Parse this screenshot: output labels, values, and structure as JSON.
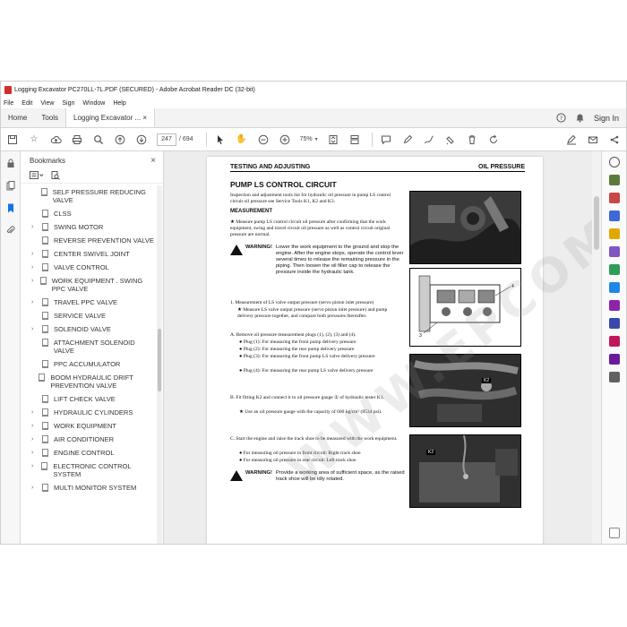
{
  "window": {
    "title": "Logging Excavator PC270LL-7L.PDF (SECURED) - Adobe Acrobat Reader DC (32-bit)"
  },
  "menu": [
    "File",
    "Edit",
    "View",
    "Sign",
    "Window",
    "Help"
  ],
  "tabs": {
    "home": "Home",
    "tools": "Tools",
    "document": "Logging Excavator ...",
    "close": "×",
    "signin": "Sign In"
  },
  "toolbar": {
    "page_current": "247",
    "page_total": "/ 694",
    "zoom": "75%"
  },
  "bookmarks": {
    "title": "Bookmarks",
    "items": [
      {
        "label": "SELF PRESSURE REDUCING VALVE",
        "expandable": false
      },
      {
        "label": "CLSS",
        "expandable": false
      },
      {
        "label": "SWING MOTOR",
        "expandable": true
      },
      {
        "label": "REVERSE PREVENTION VALVE",
        "expandable": false
      },
      {
        "label": "CENTER SWIVEL JOINT",
        "expandable": true
      },
      {
        "label": "VALVE CONTROL",
        "expandable": true
      },
      {
        "label": "WORK EQUIPMENT . SWING PPC VALVE",
        "expandable": true
      },
      {
        "label": "TRAVEL PPC VALVE",
        "expandable": true
      },
      {
        "label": "SERVICE VALVE",
        "expandable": false
      },
      {
        "label": "SOLENOID VALVE",
        "expandable": true
      },
      {
        "label": "ATTACHMENT SOLENOID VALVE",
        "expandable": false
      },
      {
        "label": "PPC ACCUMULATOR",
        "expandable": false
      },
      {
        "label": "BOOM HYDRAULIC DRIFT PREVENTION VALVE",
        "expandable": false
      },
      {
        "label": "LIFT CHECK VALVE",
        "expandable": false
      },
      {
        "label": "HYDRAULIC CYLINDERS",
        "expandable": true
      },
      {
        "label": "WORK EQUIPMENT",
        "expandable": true
      },
      {
        "label": "AIR CONDITIONER",
        "expandable": true
      },
      {
        "label": "ENGINE CONTROL",
        "expandable": true
      },
      {
        "label": "ELECTRONIC CONTROL SYSTEM",
        "expandable": true
      },
      {
        "label": "MULTI MONITOR SYSTEM",
        "expandable": true
      }
    ]
  },
  "doc": {
    "header_left": "TESTING AND ADJUSTING",
    "header_right": "OIL PRESSURE",
    "title": "PUMP LS CONTROL CIRCUIT",
    "intro": "Inspection and adjustment tools list for hydraulic oil pressure in pump LS control circuit oil pressure see Service Tools K1, K2 and K3.",
    "measurement": "MEASUREMENT",
    "star1": "★  Measure pump LS control circuit oil pressure after confirming that the work equipment, swing and travel circuit oil pressure as well as control circuit original pressure are normal.",
    "warning_label": "WARNING!",
    "warning1": "Lower the work equipment to the ground and stop the engine. After the engine stops, operate the control lever several times to release the remaining pressure in the piping. Then loosen the oil filler cap to release the pressure inside the hydraulic tank.",
    "step1": "1.  Measurement of LS valve output pressure (servo piston inlet pressure)",
    "star2": "★  Measure LS valve output pressure (servo piston inlet pressure) and pump delivery pressure together, and compare both pressures thereafter.",
    "stepA": "A.  Remove oil pressure measurement plugs (1), (2), (3) and (4).",
    "plugs": [
      "●  Plug (1): For measuring the front pump delivery pressure",
      "●  Plug (2): For measuring the rear pump delivery pressure",
      "●  Plug (3): For measuring the front pump LS valve delivery pressure",
      "●  Plug (4): For measuring the rear pump LS valve delivery pressure"
    ],
    "stepB": "B.  Fit fitting K2 and connect it to oil pressure gauge ① of hydraulic tester K1.",
    "stepB_star": "★  Use an oil pressure gauge with the capacity of 600 kg/cm² (8534 psi).",
    "stepC": "C.  Start the engine and raise the track shoe to be measured with the work equipment.",
    "stepC_items": [
      "●  For measuring oil pressure in front circuit: Right track shoe",
      "●  For measuring oil pressure in rear circuit: Left track shoe"
    ],
    "warning2": "Provide a working area of sufficient space, as the raised track shoe will be idly rotated.",
    "photo_labels": {
      "k2_a": "K2",
      "k2_b": "K2",
      "diag_3": "3",
      "diag_4": "4"
    },
    "watermark": "WWW.EPCOMPU"
  }
}
